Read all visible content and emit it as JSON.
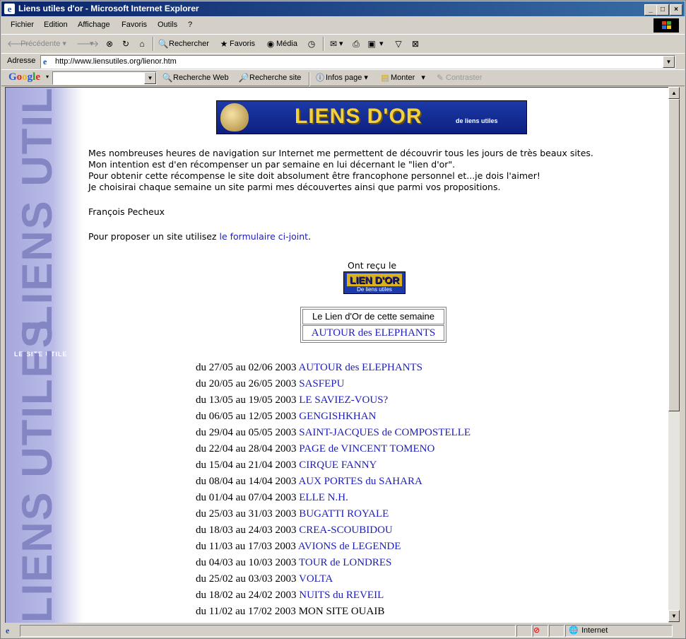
{
  "window": {
    "title": "Liens utiles d'or - Microsoft Internet Explorer",
    "min": "_",
    "max": "□",
    "close": "×"
  },
  "menu": [
    "Fichier",
    "Edition",
    "Affichage",
    "Favoris",
    "Outils",
    "?"
  ],
  "toolbar": {
    "back": "Précédente",
    "search": "Rechercher",
    "favorites": "Favoris",
    "media": "Média"
  },
  "address": {
    "label": "Adresse",
    "url": "http://www.liensutiles.org/lienor.htm"
  },
  "google": {
    "logo": "Google",
    "search_web": "Recherche Web",
    "search_site": "Recherche site",
    "page_info": "Infos page",
    "up": "Monter",
    "contrast": "Contraster"
  },
  "sidebar": {
    "text_top": "LIENS UTILES",
    "small": "LE SITE UTILE",
    "text_bottom": "LIENS UTILES"
  },
  "banner": {
    "title": "LIENS D'OR",
    "subtitle": "de liens utiles"
  },
  "intro": {
    "lines": [
      "Mes nombreuses heures de navigation sur Internet me permettent de découvrir tous les jours de très beaux sites.",
      "Mon intention est d'en récompenser un par semaine en lui décernant le \"lien d'or\".",
      "Pour obtenir cette récompense le site doit absolument être francophone personnel et...je dois l'aimer!",
      "Je choisirai chaque semaine un site parmi mes découvertes ainsi que parmi vos propositions."
    ],
    "author": "François Pecheux",
    "propose_prefix": "Pour proposer un site utilisez ",
    "propose_link": "le formulaire ci-joint",
    "propose_suffix": "."
  },
  "award": {
    "caption": "Ont reçu le",
    "badge_title": "LIEN D'OR",
    "badge_sub": "De liens utiles"
  },
  "current_week": {
    "heading": "Le Lien d'Or de cette semaine",
    "site": "AUTOUR des ELEPHANTS"
  },
  "history": [
    {
      "dates": "du 27/05 au 02/06 2003",
      "site": "AUTOUR des ELEPHANTS",
      "link": true
    },
    {
      "dates": "du 20/05 au 26/05 2003",
      "site": "SASFEPU",
      "link": true
    },
    {
      "dates": "du 13/05 au 19/05 2003",
      "site": "LE SAVIEZ-VOUS?",
      "link": true
    },
    {
      "dates": "du 06/05 au 12/05 2003",
      "site": "GENGISHKHAN",
      "link": true
    },
    {
      "dates": "du 29/04 au 05/05 2003",
      "site": "SAINT-JACQUES de COMPOSTELLE",
      "link": true
    },
    {
      "dates": "du 22/04 au 28/04 2003",
      "site": "PAGE de VINCENT TOMENO",
      "link": true
    },
    {
      "dates": "du 15/04 au 21/04 2003",
      "site": "CIRQUE FANNY",
      "link": true
    },
    {
      "dates": "du 08/04 au 14/04 2003",
      "site": "AUX PORTES du SAHARA",
      "link": true
    },
    {
      "dates": "du 01/04 au 07/04 2003",
      "site": "ELLE N.H.",
      "link": true
    },
    {
      "dates": "du 25/03 au 31/03 2003",
      "site": "BUGATTI ROYALE",
      "link": true
    },
    {
      "dates": "du 18/03 au 24/03 2003",
      "site": "CREA-SCOUBIDOU",
      "link": true
    },
    {
      "dates": "du 11/03 au 17/03 2003",
      "site": "AVIONS de LEGENDE",
      "link": true
    },
    {
      "dates": "du 04/03 au 10/03 2003",
      "site": "TOUR de LONDRES",
      "link": true
    },
    {
      "dates": "du 25/02 au 03/03 2003",
      "site": "VOLTA",
      "link": true
    },
    {
      "dates": "du 18/02 au 24/02 2003",
      "site": "NUITS du REVEIL",
      "link": true
    },
    {
      "dates": "du 11/02 au 17/02 2003",
      "site": "MON SITE OUAIB",
      "link": false
    }
  ],
  "status": {
    "zone": "Internet"
  },
  "colors": {
    "link": "#1d1db8",
    "title_bar": "#0a246a",
    "banner_bg": "#1c3aa8",
    "banner_text": "#f2d040"
  }
}
